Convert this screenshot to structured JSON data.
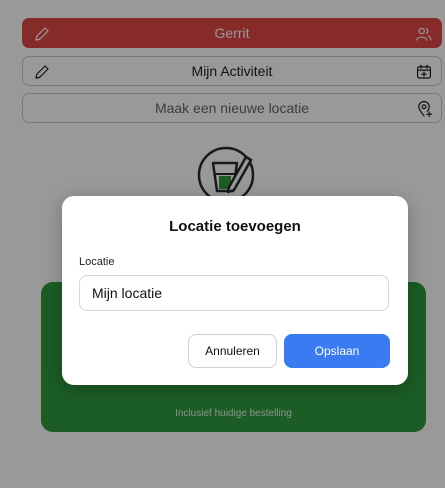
{
  "header": {
    "user_name": "Gerrit",
    "activity_label": "Mijn Activiteit",
    "new_location_label": "Maak een nieuwe locatie"
  },
  "card": {
    "subtitle": "Inclusief huidige bestelling"
  },
  "dialog": {
    "title": "Locatie toevoegen",
    "field_label": "Locatie",
    "field_value": "Mijn locatie",
    "cancel_label": "Annuleren",
    "save_label": "Opslaan"
  },
  "colors": {
    "user_bar": "#e24647",
    "card_green": "#2e9b3f",
    "primary_button": "#3b7bf2"
  },
  "icons": {
    "user_bar_left": "pencil-icon",
    "user_bar_right": "users-icon",
    "activity_left": "pencil-icon",
    "activity_right": "calendar-plus-icon",
    "location_right": "location-pin-plus-icon",
    "hero": "drink-glass-pencil-icon"
  }
}
